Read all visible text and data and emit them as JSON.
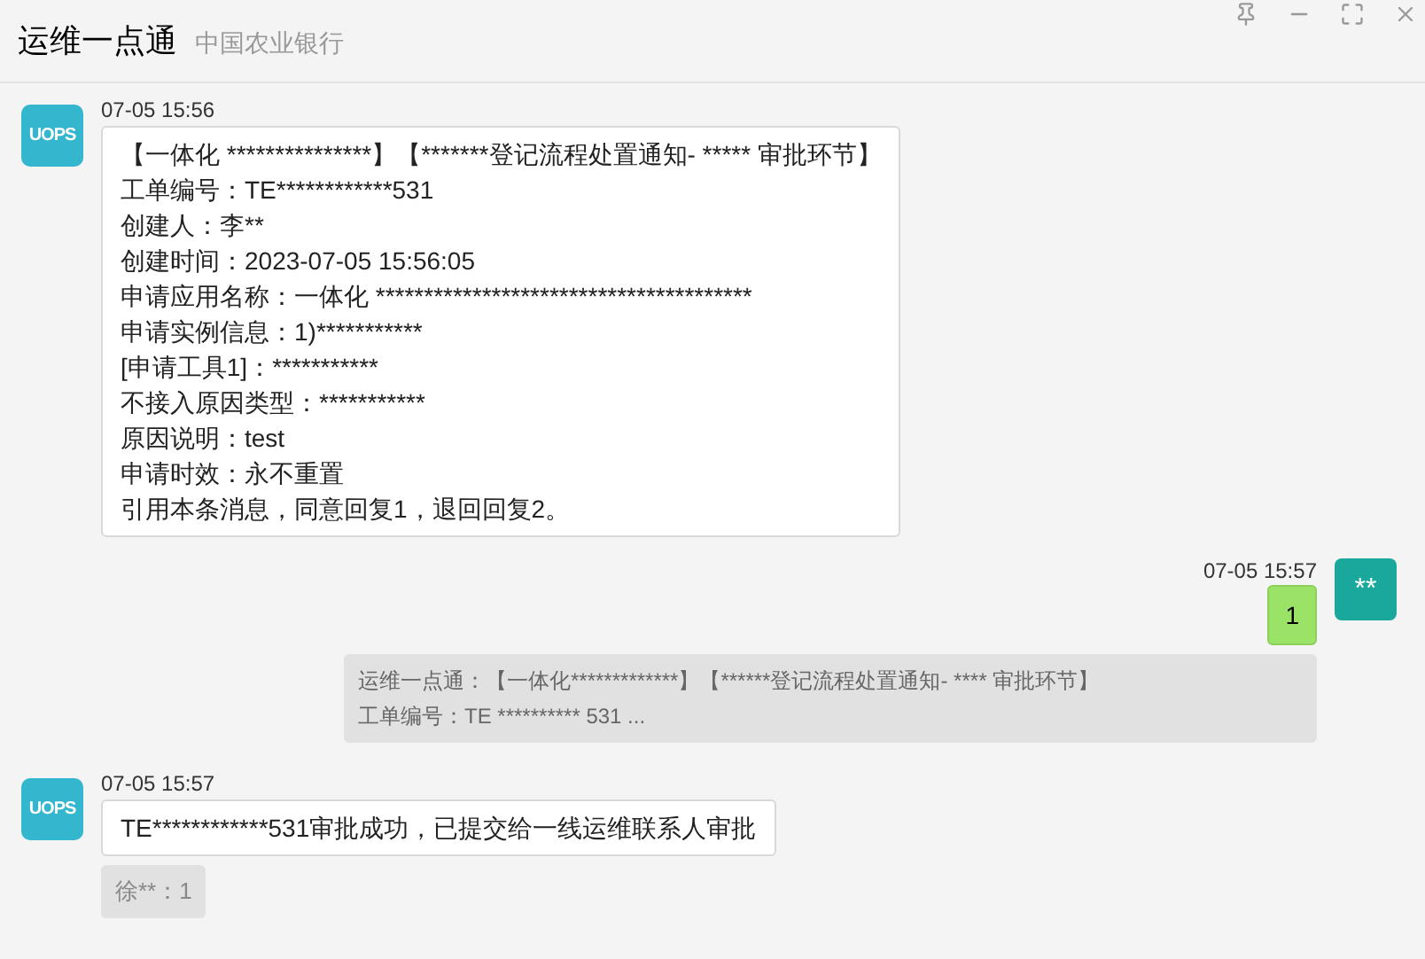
{
  "window": {
    "title": "运维一点通",
    "subtitle": "中国农业银行"
  },
  "messages": [
    {
      "kind": "incoming",
      "avatar": "UOPS",
      "time": "07-05 15:56",
      "lines": [
        "【一体化 ***************】【*******登记流程处置通知- ***** 审批环节】",
        "工单编号：TE************531",
        "创建人：李**",
        "创建时间：2023-07-05 15:56:05",
        "申请应用名称：一体化 ***************************************",
        "申请实例信息：1)***********",
        "[申请工具1]：***********",
        "不接入原因类型：***********",
        "原因说明：test",
        "申请时效：永不重置",
        "引用本条消息，同意回复1，退回回复2。"
      ]
    },
    {
      "kind": "outgoing",
      "avatar": "**",
      "time": "07-05 15:57",
      "lines": [
        "1"
      ],
      "quote": [
        "运维一点通：【一体化*************】【******登记流程处置通知- **** 审批环节】",
        "工单编号：TE ********** 531 ..."
      ]
    },
    {
      "kind": "incoming",
      "avatar": "UOPS",
      "time": "07-05 15:57",
      "lines": [
        "TE************531审批成功，已提交给一线运维联系人审批"
      ],
      "reply": "徐**：1"
    }
  ]
}
